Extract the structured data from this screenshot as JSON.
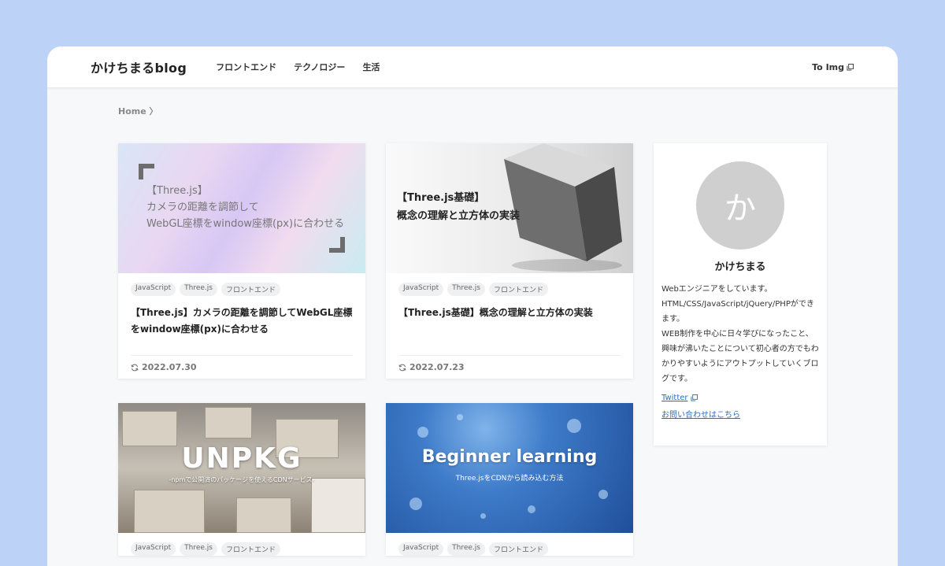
{
  "header": {
    "logo": "かけちまるblog",
    "nav": [
      "フロントエンド",
      "テクノロジー",
      "生活"
    ],
    "right_link": "To Img"
  },
  "breadcrumb": "Home 〉",
  "posts": [
    {
      "thumb_lines": [
        "【Three.js】",
        "カメラの距離を調節して",
        "WebGL座標をwindow座標(px)に合わせる"
      ],
      "tags": [
        "JavaScript",
        "Three.js",
        "フロントエンド"
      ],
      "title": "【Three.js】カメラの距離を調節してWebGL座標をwindow座標(px)に合わせる",
      "date": "2022.07.30"
    },
    {
      "thumb_lines": [
        "【Three.js基礎】",
        "概念の理解と立方体の実装"
      ],
      "tags": [
        "JavaScript",
        "Three.js",
        "フロントエンド"
      ],
      "title": "【Three.js基礎】概念の理解と立方体の実装",
      "date": "2022.07.23"
    },
    {
      "thumb_big": "UNPKG",
      "thumb_sub": "-npmで公開済のパッケージを使えるCDNサービス-",
      "tags": [
        "JavaScript",
        "Three.js",
        "フロントエンド"
      ]
    },
    {
      "thumb_big": "Beginner learning",
      "thumb_sub": "Three.jsをCDNから読み込む方法",
      "tags": [
        "JavaScript",
        "Three.js",
        "フロントエンド"
      ]
    }
  ],
  "profile": {
    "avatar_char": "か",
    "name": "かけちまる",
    "bio": "Webエンジニアをしています。\nHTML/CSS/JavaScript/jQuery/PHPができます。\nWEB制作を中心に日々学びになったこと、興味が沸いたことについて初心者の方でもわかりやすいようにアウトプットしていくブログです。",
    "twitter": "Twitter",
    "contact": "お問い合わせはこちら"
  },
  "colors": {
    "background": "#bcd3f7",
    "link": "#2a6ebb"
  }
}
